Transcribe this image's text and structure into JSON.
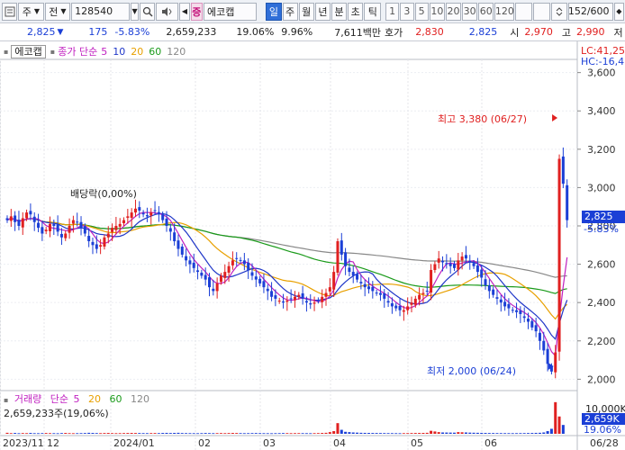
{
  "toolbar": {
    "type_sel": "주",
    "market_sel": "전",
    "code": "128540",
    "stock_name": "에코캡",
    "stock_badge": "증",
    "period_tabs": [
      "일",
      "주",
      "월",
      "년",
      "분",
      "초",
      "틱"
    ],
    "active_period": "일",
    "interval_tabs": [
      "1",
      "3",
      "5",
      "10",
      "20",
      "30",
      "60",
      "120"
    ],
    "count": "152/600"
  },
  "info": {
    "price": "2,825",
    "change": "175",
    "change_pct": "-5.83%",
    "volume": "2,659,233",
    "vol_ratio": "19.06%",
    "turnover": "9.96%",
    "amount": "7,611백만",
    "quote_label": "호가",
    "ask": "2,830",
    "bid": "2,825",
    "open_label": "시",
    "open": "2,970",
    "high_label": "고",
    "high": "2,990",
    "low_label": "저"
  },
  "price_panel": {
    "name": "에코캡",
    "ma_label": "종가 단순",
    "ma_periods": [
      "5",
      "10",
      "20",
      "60",
      "120"
    ],
    "ma_colors": [
      "#c020c0",
      "#1f36c8",
      "#e8a000",
      "#1a9a1a",
      "#888888"
    ],
    "lc_label": "LC:41,25",
    "hc_label": "HC:-16,4",
    "dividend_label": "배당락(0,00%)",
    "high_note": "최고 3,380 (06/27)",
    "low_note": "최저 2,000 (06/24)",
    "last_price": "2,825",
    "last_pct": "-5.83%"
  },
  "volume_panel": {
    "label": "거래량",
    "ma_label": "단순",
    "ma_periods": [
      "5",
      "20",
      "60",
      "120"
    ],
    "value_label": "2,659,233주(19,06%)",
    "axis_top": "10,000K",
    "last_value": "2,659K",
    "last_pct": "19.06%"
  },
  "chart_data": {
    "type": "candlestick",
    "ylim": [
      1950,
      3650
    ],
    "yticks": [
      2000,
      2200,
      2400,
      2600,
      2800,
      3000,
      3200,
      3400,
      3600
    ],
    "ytick_labels": [
      "2,000",
      "2,200",
      "2,400",
      "2,600",
      "2,800",
      "3,000",
      "3,200",
      "3,400",
      "3,600"
    ],
    "x_labels": [
      "2023/11",
      "12",
      "2024/01",
      "02",
      "03",
      "04",
      "05",
      "06",
      "06/28"
    ],
    "closes": [
      2830,
      2850,
      2820,
      2800,
      2840,
      2870,
      2860,
      2820,
      2790,
      2760,
      2780,
      2810,
      2800,
      2770,
      2740,
      2760,
      2800,
      2830,
      2820,
      2790,
      2760,
      2720,
      2700,
      2680,
      2700,
      2740,
      2760,
      2790,
      2800,
      2810,
      2830,
      2850,
      2870,
      2890,
      2880,
      2860,
      2850,
      2870,
      2880,
      2860,
      2830,
      2800,
      2770,
      2720,
      2680,
      2650,
      2620,
      2600,
      2580,
      2560,
      2540,
      2520,
      2480,
      2460,
      2500,
      2540,
      2560,
      2590,
      2620,
      2630,
      2620,
      2600,
      2570,
      2540,
      2520,
      2500,
      2480,
      2460,
      2430,
      2420,
      2410,
      2400,
      2410,
      2420,
      2430,
      2440,
      2420,
      2400,
      2390,
      2400,
      2410,
      2430,
      2450,
      2480,
      2560,
      2720,
      2650,
      2590,
      2560,
      2540,
      2520,
      2500,
      2480,
      2470,
      2460,
      2450,
      2440,
      2420,
      2400,
      2380,
      2370,
      2360,
      2360,
      2380,
      2400,
      2420,
      2440,
      2450,
      2460,
      2570,
      2600,
      2630,
      2610,
      2600,
      2590,
      2580,
      2620,
      2640,
      2630,
      2610,
      2590,
      2560,
      2530,
      2490,
      2460,
      2440,
      2420,
      2400,
      2380,
      2370,
      2360,
      2350,
      2340,
      2320,
      2300,
      2270,
      2250,
      2200,
      2150,
      2080,
      2040,
      2140,
      3150,
      3020,
      2830
    ],
    "ma5_color": "#c020c0",
    "ma10_color": "#1f36c8",
    "ma20_color": "#e8a000",
    "ma60_color": "#1a9a1a",
    "ma120_color": "#888888",
    "volumes_k": [
      300,
      200,
      250,
      180,
      220,
      200,
      260,
      190,
      180,
      210,
      240,
      200,
      190,
      170,
      220,
      260,
      200,
      180,
      190,
      210,
      230,
      300,
      260,
      220,
      200,
      230,
      260,
      210,
      190,
      200,
      220,
      250,
      260,
      240,
      230,
      210,
      200,
      220,
      230,
      210,
      260,
      280,
      240,
      270,
      300,
      230,
      210,
      200,
      190,
      180,
      200,
      240,
      210,
      190,
      210,
      220,
      200,
      230,
      260,
      240,
      210,
      190,
      200,
      220,
      230,
      210,
      190,
      180,
      170,
      190,
      200,
      220,
      210,
      190,
      200,
      210,
      200,
      190,
      180,
      200,
      220,
      260,
      300,
      500,
      800,
      3200,
      1200,
      600,
      500,
      400,
      350,
      300,
      280,
      260,
      250,
      240,
      230,
      220,
      210,
      200,
      190,
      180,
      200,
      210,
      230,
      250,
      260,
      270,
      300,
      900,
      700,
      500,
      400,
      380,
      360,
      340,
      500,
      450,
      400,
      350,
      320,
      300,
      280,
      260,
      240,
      230,
      220,
      210,
      200,
      200,
      190,
      200,
      210,
      220,
      230,
      250,
      280,
      300,
      400,
      800,
      1500,
      9500,
      5200,
      2659
    ]
  }
}
